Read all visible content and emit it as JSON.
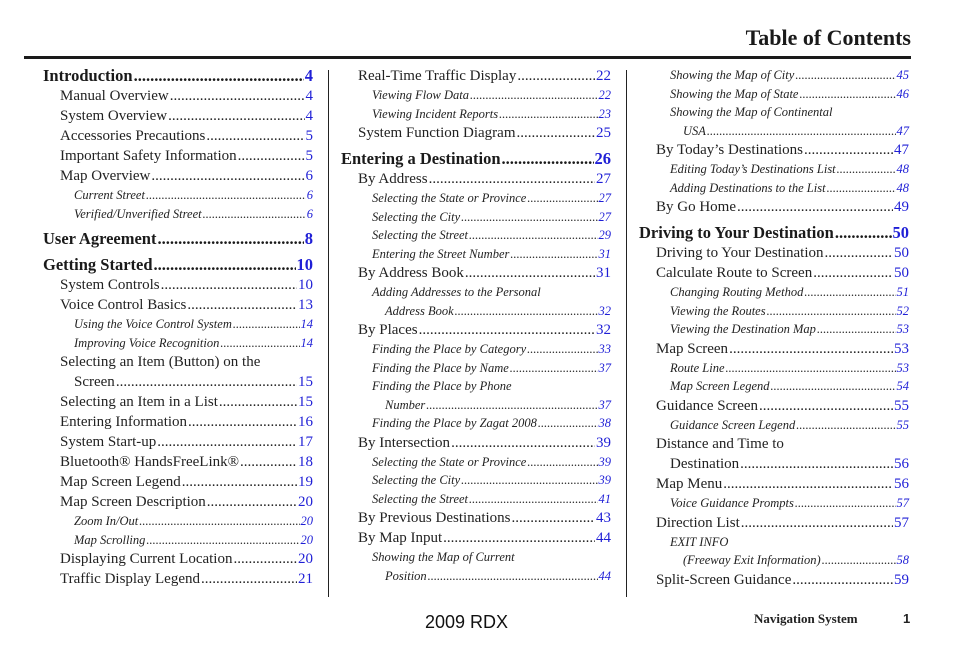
{
  "header": {
    "title": "Table of Contents"
  },
  "columns": [
    [
      {
        "level": 1,
        "label": "Introduction",
        "page": "4"
      },
      {
        "level": 2,
        "label": "Manual Overview",
        "page": "4"
      },
      {
        "level": 2,
        "label": "System Overview",
        "page": "4"
      },
      {
        "level": 2,
        "label": "Accessories Precautions",
        "page": "5"
      },
      {
        "level": 2,
        "label": "Important Safety Information",
        "page": "5"
      },
      {
        "level": 2,
        "label": "Map Overview",
        "page": "6"
      },
      {
        "level": 3,
        "label": "Current Street",
        "page": "6"
      },
      {
        "level": 3,
        "label": "Verified/Unverified Street",
        "page": "6"
      },
      {
        "level": 1,
        "label": "User Agreement",
        "page": "8"
      },
      {
        "level": 1,
        "label": "Getting Started",
        "page": "10"
      },
      {
        "level": 2,
        "label": "System Controls",
        "page": "10"
      },
      {
        "level": 2,
        "label": "Voice Control Basics",
        "page": "13"
      },
      {
        "level": 3,
        "label": "Using the Voice Control System",
        "page": "14"
      },
      {
        "level": 3,
        "label": "Improving Voice Recognition",
        "page": "14"
      },
      {
        "level": 2,
        "label": "Selecting an Item (Button) on the",
        "cont": "Screen",
        "page": "15"
      },
      {
        "level": 2,
        "label": "Selecting an Item in a List",
        "page": "15"
      },
      {
        "level": 2,
        "label": "Entering Information",
        "page": "16"
      },
      {
        "level": 2,
        "label": "System Start-up",
        "page": "17"
      },
      {
        "level": 2,
        "label": "Bluetooth® HandsFreeLink®",
        "page": "18"
      },
      {
        "level": 2,
        "label": "Map Screen Legend",
        "page": "19"
      },
      {
        "level": 2,
        "label": "Map Screen Description",
        "page": "20"
      },
      {
        "level": 3,
        "label": "Zoom In/Out",
        "page": "20"
      },
      {
        "level": 3,
        "label": "Map Scrolling",
        "page": "20"
      },
      {
        "level": 2,
        "label": "Displaying Current Location",
        "page": "20"
      },
      {
        "level": 2,
        "label": "Traffic Display Legend",
        "page": "21"
      }
    ],
    [
      {
        "level": 2,
        "label": "Real-Time Traffic Display",
        "page": "22"
      },
      {
        "level": 3,
        "label": "Viewing Flow Data",
        "page": "22"
      },
      {
        "level": 3,
        "label": "Viewing Incident Reports",
        "page": "23"
      },
      {
        "level": 2,
        "label": "System Function Diagram",
        "page": "25"
      },
      {
        "level": 1,
        "label": "Entering a Destination",
        "page": "26"
      },
      {
        "level": 2,
        "label": "By Address",
        "page": "27"
      },
      {
        "level": 3,
        "label": "Selecting the State or Province",
        "page": "27"
      },
      {
        "level": 3,
        "label": "Selecting the City",
        "page": "27"
      },
      {
        "level": 3,
        "label": "Selecting the Street",
        "page": "29"
      },
      {
        "level": 3,
        "label": "Entering the Street Number",
        "page": "31"
      },
      {
        "level": 2,
        "label": "By Address Book",
        "page": "31"
      },
      {
        "level": 3,
        "label": "Adding Addresses to the Personal",
        "cont": "Address Book",
        "page": "32"
      },
      {
        "level": 2,
        "label": "By Places",
        "page": "32"
      },
      {
        "level": 3,
        "label": "Finding the Place by Category",
        "page": "33"
      },
      {
        "level": 3,
        "label": "Finding the Place by Name",
        "page": "37"
      },
      {
        "level": 3,
        "label": "Finding the Place by Phone",
        "cont": "Number",
        "page": "37"
      },
      {
        "level": 3,
        "label": "Finding the Place by Zagat 2008",
        "page": "38"
      },
      {
        "level": 2,
        "label": "By Intersection",
        "page": "39"
      },
      {
        "level": 3,
        "label": "Selecting the State or Province",
        "page": "39"
      },
      {
        "level": 3,
        "label": "Selecting the City",
        "page": "39"
      },
      {
        "level": 3,
        "label": "Selecting the Street",
        "page": "41"
      },
      {
        "level": 2,
        "label": "By Previous Destinations",
        "page": "43"
      },
      {
        "level": 2,
        "label": "By Map Input",
        "page": "44"
      },
      {
        "level": 3,
        "label": "Showing the Map of Current",
        "cont": "Position",
        "page": "44"
      }
    ],
    [
      {
        "level": 3,
        "label": "Showing the Map of City",
        "page": "45"
      },
      {
        "level": 3,
        "label": "Showing the Map of State",
        "page": "46"
      },
      {
        "level": 3,
        "label": "Showing the Map of Continental",
        "cont": "USA",
        "page": "47"
      },
      {
        "level": 2,
        "label": "By Today’s Destinations",
        "page": "47"
      },
      {
        "level": 3,
        "label": "Editing Today’s Destinations List",
        "page": "48"
      },
      {
        "level": 3,
        "label": "Adding Destinations to the List",
        "page": "48"
      },
      {
        "level": 2,
        "label": "By Go Home",
        "page": "49"
      },
      {
        "level": 1,
        "label": "Driving to Your Destination",
        "page": "50"
      },
      {
        "level": 2,
        "label": "Driving to Your Destination",
        "page": "50"
      },
      {
        "level": 2,
        "label": "Calculate Route to Screen",
        "page": "50"
      },
      {
        "level": 3,
        "label": "Changing Routing Method",
        "page": "51"
      },
      {
        "level": 3,
        "label": "Viewing the Routes",
        "page": "52"
      },
      {
        "level": 3,
        "label": "Viewing the Destination Map",
        "page": "53"
      },
      {
        "level": 2,
        "label": "Map Screen",
        "page": "53"
      },
      {
        "level": 3,
        "label": "Route Line",
        "page": "53"
      },
      {
        "level": 3,
        "label": "Map Screen Legend",
        "page": "54"
      },
      {
        "level": 2,
        "label": "Guidance Screen",
        "page": "55"
      },
      {
        "level": 3,
        "label": "Guidance Screen Legend",
        "page": "55"
      },
      {
        "level": 2,
        "label": "Distance and Time to",
        "cont": "Destination",
        "page": "56"
      },
      {
        "level": 2,
        "label": "Map Menu",
        "page": "56"
      },
      {
        "level": 3,
        "label": "Voice Guidance Prompts",
        "page": "57"
      },
      {
        "level": 2,
        "label": "Direction List",
        "page": "57"
      },
      {
        "level": 3,
        "label": "EXIT INFO",
        "cont": "(Freeway Exit Information)",
        "page": "58"
      },
      {
        "level": 2,
        "label": "Split-Screen Guidance",
        "page": "59"
      }
    ]
  ],
  "footer": {
    "model": "2009  RDX",
    "section": "Navigation System",
    "page_number": "1"
  },
  "colors": {
    "link": "#1f1fd6",
    "text": "#222222"
  }
}
